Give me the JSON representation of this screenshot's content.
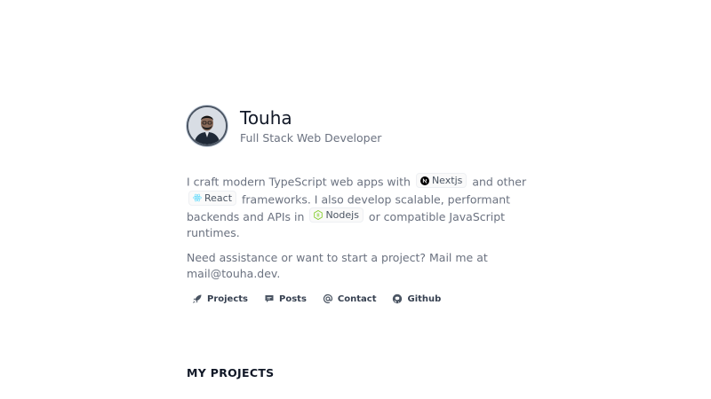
{
  "profile": {
    "name": "Touha",
    "title": "Full Stack Web Developer"
  },
  "bio": {
    "part1": "I craft modern TypeScript web apps with",
    "chip_nextjs": "Nextjs",
    "part2": "and other",
    "chip_react": "React",
    "part3": "frameworks. I also develop scalable, performant backends and APIs in",
    "chip_nodejs": "Nodejs",
    "part4": "or compatible JavaScript runtimes.",
    "mail_text": "Need assistance or want to start a project? Mail me at mail@touha.dev."
  },
  "nav": {
    "items": [
      {
        "label": "Projects",
        "icon": "rocket-icon"
      },
      {
        "label": "Posts",
        "icon": "chat-icon"
      },
      {
        "label": "Contact",
        "icon": "at-icon"
      },
      {
        "label": "Github",
        "icon": "github-icon"
      }
    ]
  },
  "section": {
    "heading": "MY PROJECTS"
  },
  "colors": {
    "text": "#111827",
    "muted": "#6b7280",
    "nav": "#374151",
    "react": "#61dafb",
    "node": "#83cd29"
  }
}
